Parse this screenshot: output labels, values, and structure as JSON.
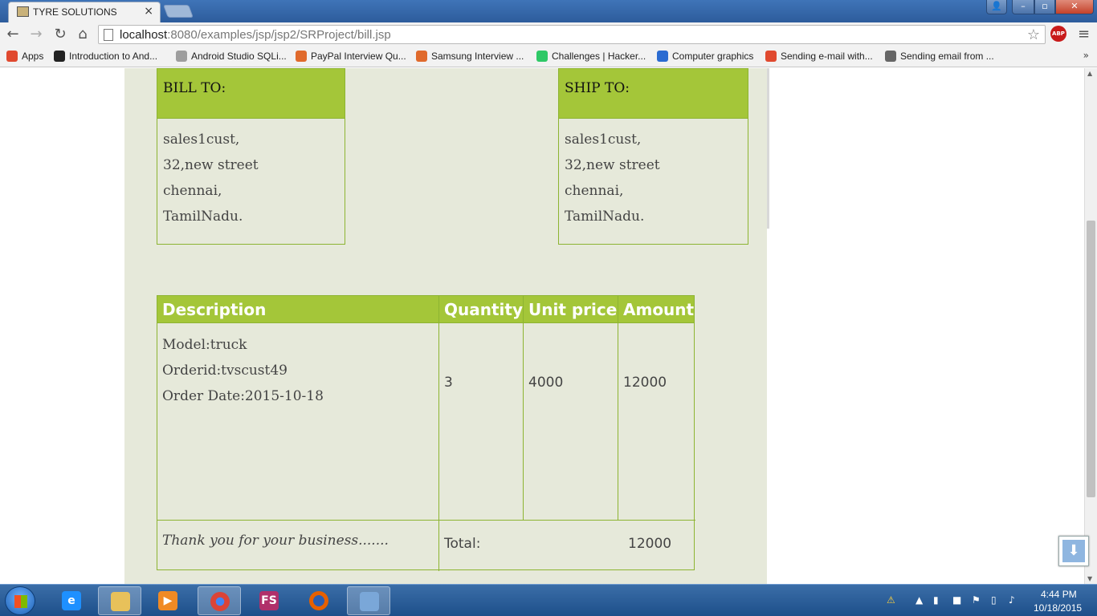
{
  "browser": {
    "tab_title": "TYRE SOLUTIONS",
    "tab_close": "×",
    "url_host": "localhost",
    "url_rest": ":8080/examples/jsp/jsp2/SRProject/bill.jsp",
    "abp_label": "ABP"
  },
  "bookmarks": [
    {
      "label": "Apps",
      "color": "#e0492f"
    },
    {
      "label": "Introduction to And...",
      "color": "#222222"
    },
    {
      "label": "Android Studio SQLi...",
      "color": "#9e9e9e"
    },
    {
      "label": "PayPal Interview Qu...",
      "color": "#e06a2c"
    },
    {
      "label": "Samsung Interview ...",
      "color": "#e06a2c"
    },
    {
      "label": "Challenges | Hacker...",
      "color": "#2ec866"
    },
    {
      "label": "Computer graphics",
      "color": "#2b6bd1"
    },
    {
      "label": "Sending e-mail with...",
      "color": "#e0492f"
    },
    {
      "label": "Sending email from ...",
      "color": "#666666"
    }
  ],
  "bill_to": {
    "heading": "BILL TO:",
    "lines": [
      "sales1cust,",
      "32,new street",
      "chennai,",
      "TamilNadu."
    ]
  },
  "ship_to": {
    "heading": "SHIP TO:",
    "lines": [
      "sales1cust,",
      "32,new street",
      "chennai,",
      "TamilNadu."
    ]
  },
  "items_table": {
    "headers": {
      "description": "Description",
      "quantity": "Quantity",
      "unit_price": "Unit price",
      "amount": "Amount"
    },
    "row": {
      "description_lines": [
        "Model:truck",
        "Orderid:tvscust49",
        "Order Date:2015-10-18"
      ],
      "quantity": "3",
      "unit_price": "4000",
      "amount": "12000"
    },
    "thank_you": "Thank you for your business.......",
    "total_label": "Total:",
    "total_value": "12000"
  },
  "taskbar": {
    "apps": [
      {
        "name": "internet-explorer",
        "glyph": "e",
        "color": "#1e90ff"
      },
      {
        "name": "file-explorer",
        "glyph": "",
        "color": "#e8c15a"
      },
      {
        "name": "media-player",
        "glyph": "▶",
        "color": "#f08a24"
      },
      {
        "name": "chrome",
        "glyph": "",
        "color": "#db4437"
      },
      {
        "name": "fs-app",
        "glyph": "FS",
        "color": "#b0306a"
      },
      {
        "name": "firefox",
        "glyph": "",
        "color": "#e66000"
      },
      {
        "name": "paint",
        "glyph": "",
        "color": "#7aa7d8"
      }
    ],
    "time": "4:44 PM",
    "date": "10/18/2015"
  }
}
